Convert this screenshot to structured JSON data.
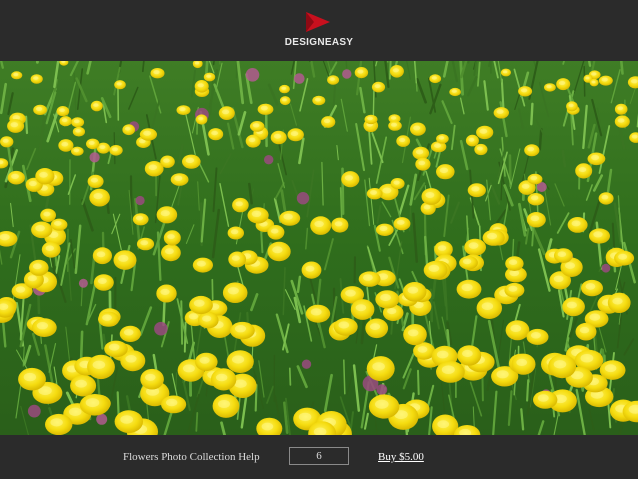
{
  "header": {
    "brand": "DESIGNEASY",
    "logo_icon": "red-triangle-logo-icon",
    "logo_color": "#c8101e"
  },
  "photo": {
    "subject": "dandelion-meadow-photo"
  },
  "footer": {
    "title": "Flowers Photo Collection Help",
    "page_number": "6",
    "buy_label": "Buy $5.00"
  }
}
